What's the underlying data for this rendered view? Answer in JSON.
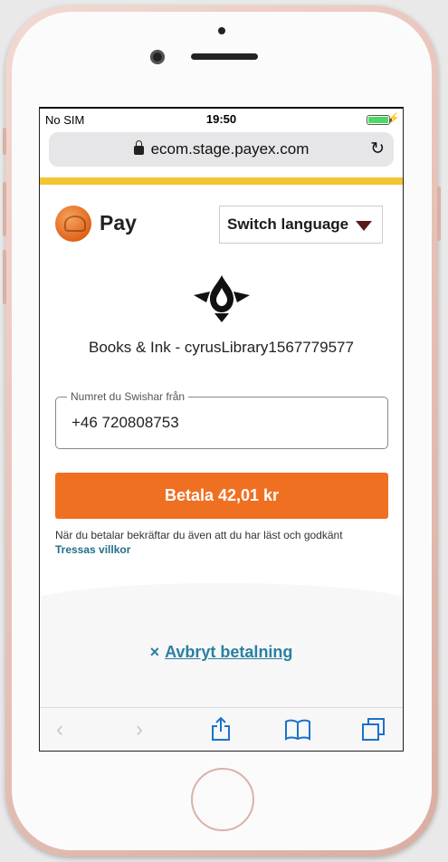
{
  "status_bar": {
    "carrier": "No SIM",
    "time": "19:50"
  },
  "browser": {
    "url": "ecom.stage.payex.com"
  },
  "header": {
    "brand": "Pay",
    "switch_language": "Switch language"
  },
  "merchant": {
    "name": "Books & Ink - cyrusLibrary1567779577"
  },
  "form": {
    "phone_label": "Numret du Swishar från",
    "phone_value": "+46 720808753",
    "pay_button": "Betala 42,01 kr",
    "terms_text": "När du betalar bekräftar du även att du har läst och godkänt",
    "terms_link": "Tressas villkor"
  },
  "cancel": {
    "icon": "×",
    "label": "Avbryt betalning"
  },
  "toolbar": {
    "back": "‹",
    "forward": "›",
    "share": "share-icon",
    "bookmarks": "book-icon",
    "tabs": "tabs-icon"
  },
  "colors": {
    "accent": "#f07022",
    "yellow_bar": "#f5c431",
    "link": "#2b7fa1"
  }
}
